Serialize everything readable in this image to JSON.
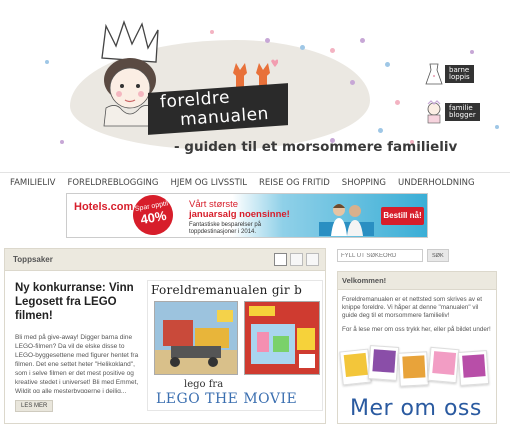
{
  "header": {
    "logo_line1": "foreldre",
    "logo_line2": "manualen",
    "tagline": "- guiden til et morsommere familieliv",
    "partners": [
      {
        "label": "barne\nloppis"
      },
      {
        "label": "familie\nblogger"
      }
    ]
  },
  "nav": {
    "items": [
      {
        "label": "FAMILIELIV"
      },
      {
        "label": "FORELDREBLOGGING"
      },
      {
        "label": "HJEM OG LIVSSTIL"
      },
      {
        "label": "REISE OG FRITID"
      },
      {
        "label": "SHOPPING"
      },
      {
        "label": "UNDERHOLDNING"
      }
    ]
  },
  "ad": {
    "logo": "Hotels.com",
    "badge_small": "Spar opptil",
    "badge_big": "40%",
    "headline_1": "Vårt største",
    "headline_2": "januarsalg noensinne!",
    "sub": "Fantastiske besparelser på toppdestinasjoner i 2014.",
    "button": "Bestill nå!",
    "colors": {
      "brand": "#d71e2b"
    }
  },
  "main": {
    "section_title": "Toppsaker",
    "post": {
      "title": "Ny konkurranse: Vinn Legosett fra LEGO filmen!",
      "excerpt": "Bli med på give-away! Digger barna dine LEGO-filmen? Da vil de elske disse to LEGO-byggesettene med figurer hentet fra filmen. Det ene settet heter \"Helikokland\", som i selve filmen er det mest positive og kreative stedet i universet! Bli med Emmet, Wildit og alle mesterbyggerne i deilig...",
      "more": "LES MER",
      "image_title": "Foreldremanualen gir b",
      "image_sub": "lego fra",
      "image_movie": "LEGO THE MOVIE"
    }
  },
  "sidebar": {
    "search_placeholder": "FYLL UT SØKEORD",
    "search_button": "SØK",
    "welcome_title": "Velkommen!",
    "welcome_p1": "Foreldremanualen er et nettsted som skrives av et knippe foreldre. Vi håper at denne \"manualen\" vil guide deg til et morsommere familieliv!",
    "welcome_p2": "For å lese mer om oss trykk her, eller på bildet under!",
    "about_link": "Mer om oss"
  }
}
